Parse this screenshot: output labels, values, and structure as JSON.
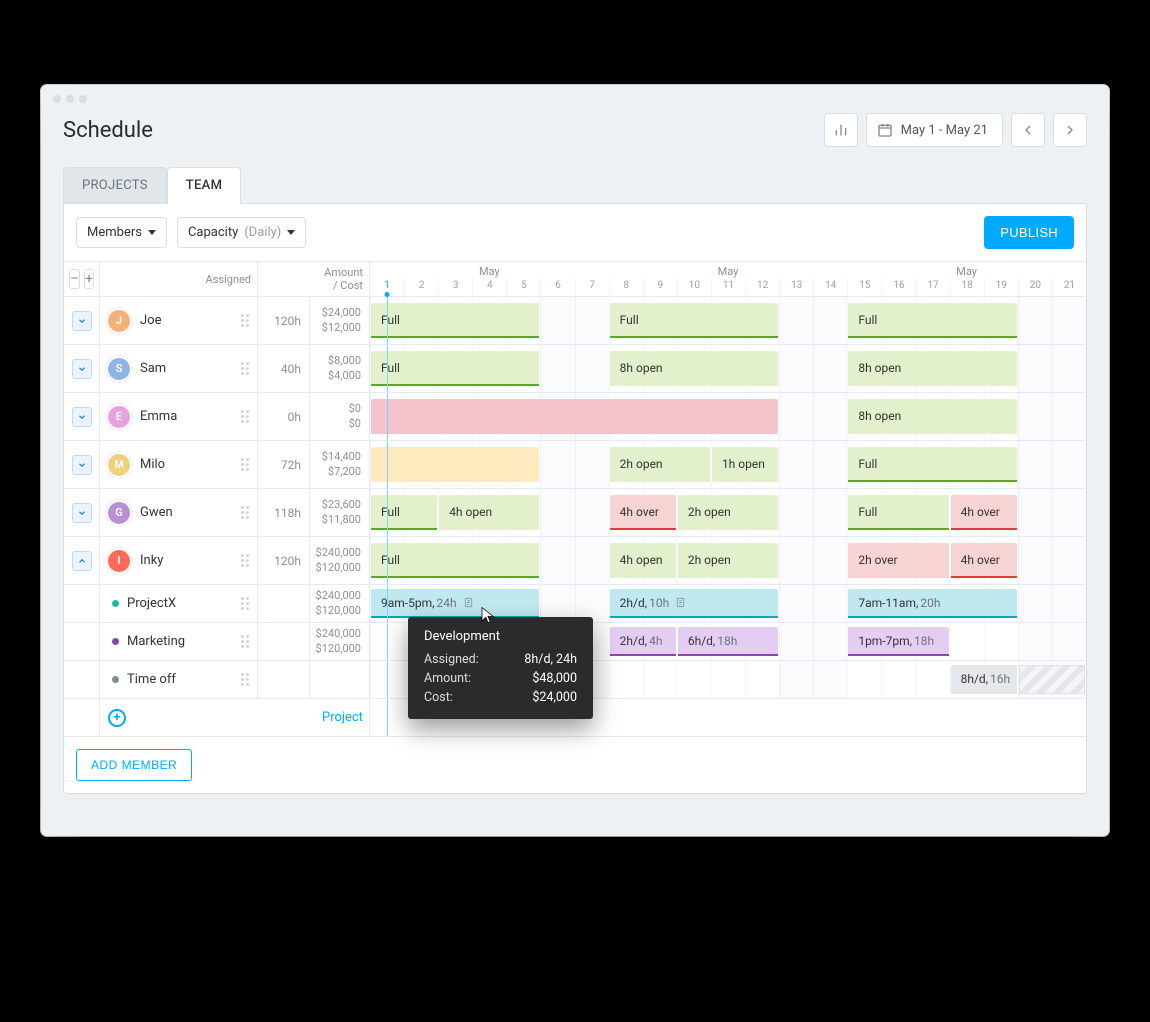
{
  "page_title": "Schedule",
  "date_range": "May 1 - May 21",
  "tabs": {
    "projects": "PROJECTS",
    "team": "TEAM"
  },
  "filters": {
    "members_label": "Members",
    "capacity_label": "Capacity",
    "capacity_qual": "(Daily)"
  },
  "publish_label": "PUBLISH",
  "add_member_label": "ADD MEMBER",
  "add_project_label": "Project",
  "columns": {
    "assigned": "Assigned",
    "amount_line1": "Amount",
    "amount_line2": "/ Cost"
  },
  "month_label": "May",
  "days": [
    "1",
    "2",
    "3",
    "4",
    "5",
    "6",
    "7",
    "8",
    "9",
    "10",
    "11",
    "12",
    "13",
    "14",
    "15",
    "16",
    "17",
    "18",
    "19",
    "20",
    "21"
  ],
  "members": [
    {
      "name": "Joe",
      "avatar_bg": "#f2b27a",
      "avatar_txt": "J",
      "assigned": "120h",
      "amount": "$24,000",
      "cost": "$12,000",
      "expanded": false,
      "bars": [
        {
          "start": 1,
          "end": 5,
          "style": "green",
          "label": "Full"
        },
        {
          "start": 8,
          "end": 12,
          "style": "green",
          "label": "Full"
        },
        {
          "start": 15,
          "end": 19,
          "style": "green",
          "label": "Full"
        }
      ]
    },
    {
      "name": "Sam",
      "avatar_bg": "#8fb4e6",
      "avatar_txt": "S",
      "assigned": "40h",
      "amount": "$8,000",
      "cost": "$4,000",
      "expanded": false,
      "bars": [
        {
          "start": 1,
          "end": 5,
          "style": "green",
          "label": "Full"
        },
        {
          "start": 8,
          "end": 12,
          "style": "green-light",
          "label": "8h open"
        },
        {
          "start": 15,
          "end": 19,
          "style": "green-light",
          "label": "8h open"
        }
      ]
    },
    {
      "name": "Emma",
      "avatar_bg": "#e7a1e1",
      "avatar_txt": "E",
      "assigned": "0h",
      "amount": "$0",
      "cost": "$0",
      "expanded": false,
      "bars": [
        {
          "start": 1,
          "end": 12,
          "style": "pink",
          "label": ""
        },
        {
          "start": 15,
          "end": 19,
          "style": "green-light",
          "label": "8h open"
        }
      ]
    },
    {
      "name": "Milo",
      "avatar_bg": "#f0d07a",
      "avatar_txt": "M",
      "assigned": "72h",
      "amount": "$14,400",
      "cost": "$7,200",
      "expanded": false,
      "bars": [
        {
          "start": 1,
          "end": 5,
          "style": "yellow",
          "label": ""
        },
        {
          "start": 8,
          "end": 10,
          "style": "green-light",
          "label": "2h open"
        },
        {
          "start": 11,
          "end": 12,
          "style": "green-light",
          "label": "1h open"
        },
        {
          "start": 15,
          "end": 19,
          "style": "green",
          "label": "Full"
        }
      ]
    },
    {
      "name": "Gwen",
      "avatar_bg": "#b98fd6",
      "avatar_txt": "G",
      "assigned": "118h",
      "amount": "$23,600",
      "cost": "$11,800",
      "expanded": false,
      "bars": [
        {
          "start": 1,
          "end": 2,
          "style": "green",
          "label": "Full"
        },
        {
          "start": 3,
          "end": 5,
          "style": "green-light",
          "label": "4h open"
        },
        {
          "start": 8,
          "end": 9,
          "style": "red",
          "label": "4h over"
        },
        {
          "start": 10,
          "end": 12,
          "style": "green-light",
          "label": "2h open"
        },
        {
          "start": 15,
          "end": 17,
          "style": "green",
          "label": "Full"
        },
        {
          "start": 18,
          "end": 19,
          "style": "red",
          "label": "4h over"
        }
      ]
    },
    {
      "name": "Inky",
      "avatar_bg": "#ff6a5b",
      "avatar_txt": "I",
      "assigned": "120h",
      "amount": "$240,000",
      "cost": "$120,000",
      "expanded": true,
      "bars": [
        {
          "start": 1,
          "end": 5,
          "style": "green",
          "label": "Full"
        },
        {
          "start": 8,
          "end": 9,
          "style": "green-light",
          "label": "4h open"
        },
        {
          "start": 10,
          "end": 12,
          "style": "green-light",
          "label": "2h open"
        },
        {
          "start": 15,
          "end": 17,
          "style": "red-flat",
          "label": "2h over"
        },
        {
          "start": 18,
          "end": 19,
          "style": "red",
          "label": "4h over"
        }
      ],
      "children": [
        {
          "name": "ProjectX",
          "dot": "#1abc9c",
          "amount": "$240,000",
          "cost": "$120,000",
          "bars": [
            {
              "start": 1,
              "end": 5,
              "style": "cyan",
              "label": "9am-5pm,",
              "label2": " 24h",
              "note": true
            },
            {
              "start": 8,
              "end": 12,
              "style": "cyan",
              "label": "2h/d,",
              "label2": " 10h",
              "note": true
            },
            {
              "start": 15,
              "end": 19,
              "style": "cyan",
              "label": "7am-11am,",
              "label2": " 20h"
            }
          ]
        },
        {
          "name": "Marketing",
          "dot": "#8e44ad",
          "amount": "$240,000",
          "cost": "$120,000",
          "bars": [
            {
              "start": 8,
              "end": 9,
              "style": "purple",
              "label": "2h/d,",
              "label2": " 4h"
            },
            {
              "start": 10,
              "end": 12,
              "style": "purple",
              "label": "6h/d,",
              "label2": " 18h"
            },
            {
              "start": 15,
              "end": 17,
              "style": "purple",
              "label": "1pm-7pm,",
              "label2": " 18h"
            }
          ]
        },
        {
          "name": "Time off",
          "dot": "#7f8c8d",
          "amount": "",
          "cost": "",
          "bars": [
            {
              "start": 18,
              "end": 19,
              "style": "grey",
              "label": "8h/d,",
              "label2": " 16h"
            },
            {
              "start": 20,
              "end": 21,
              "style": "hatch",
              "label": ""
            }
          ]
        }
      ]
    }
  ],
  "tooltip": {
    "title": "Development",
    "assigned_label": "Assigned:",
    "assigned_value": "8h/d, 24h",
    "amount_label": "Amount:",
    "amount_value": "$48,000",
    "cost_label": "Cost:",
    "cost_value": "$24,000"
  }
}
